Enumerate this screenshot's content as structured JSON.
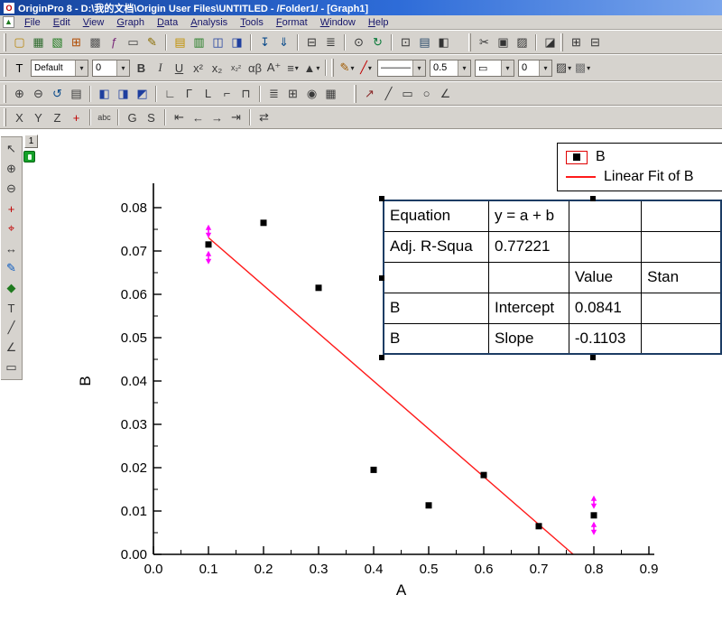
{
  "window": {
    "title": "OriginPro 8 - D:\\我的文档\\Origin User Files\\UNTITLED - /Folder1/ - [Graph1]"
  },
  "menu": {
    "items": [
      "File",
      "Edit",
      "View",
      "Graph",
      "Data",
      "Analysis",
      "Tools",
      "Format",
      "Window",
      "Help"
    ]
  },
  "toolbars": {
    "standard": [
      {
        "t": "g"
      },
      {
        "t": "i",
        "n": "new-project-icon",
        "g": "▢",
        "c": "#b8860b"
      },
      {
        "t": "i",
        "n": "new-workbook-icon",
        "g": "▦",
        "c": "#2e6b2e"
      },
      {
        "t": "i",
        "n": "new-excel-icon",
        "g": "▧",
        "c": "#1f7a1f"
      },
      {
        "t": "i",
        "n": "new-graph-icon",
        "g": "⊞",
        "c": "#b04a00"
      },
      {
        "t": "i",
        "n": "new-matrix-icon",
        "g": "▩",
        "c": "#555555"
      },
      {
        "t": "i",
        "n": "new-function-icon",
        "g": "ƒ",
        "c": "#7a2a7a"
      },
      {
        "t": "i",
        "n": "new-layout-icon",
        "g": "▭",
        "c": "#444444"
      },
      {
        "t": "i",
        "n": "new-notes-icon",
        "g": "✎",
        "c": "#8a6d00"
      },
      {
        "t": "s"
      },
      {
        "t": "i",
        "n": "open-icon",
        "g": "▤",
        "c": "#c09000"
      },
      {
        "t": "i",
        "n": "open-excel-icon",
        "g": "▥",
        "c": "#1f7a1f"
      },
      {
        "t": "i",
        "n": "save-project-icon",
        "g": "◫",
        "c": "#1f3f9f"
      },
      {
        "t": "i",
        "n": "save-template-icon",
        "g": "◨",
        "c": "#1f3f9f"
      },
      {
        "t": "s"
      },
      {
        "t": "i",
        "n": "import-wizard-icon",
        "g": "↧",
        "c": "#0a4a8a"
      },
      {
        "t": "i",
        "n": "import-ascii-icon",
        "g": "⇓",
        "c": "#0a4a8a"
      },
      {
        "t": "s"
      },
      {
        "t": "i",
        "n": "print-icon",
        "g": "⊟",
        "c": "#333333"
      },
      {
        "t": "i",
        "n": "script-window-icon",
        "g": "≣",
        "c": "#333333"
      },
      {
        "t": "s"
      },
      {
        "t": "i",
        "n": "zoom-tool-icon",
        "g": "⊙",
        "c": "#333333"
      },
      {
        "t": "i",
        "n": "refresh-icon",
        "g": "↻",
        "c": "#0a7a3a"
      },
      {
        "t": "s"
      },
      {
        "t": "i",
        "n": "project-explorer-icon",
        "g": "⊡",
        "c": "#333333"
      },
      {
        "t": "i",
        "n": "results-log-icon",
        "g": "▤",
        "c": "#2a4a6a"
      },
      {
        "t": "i",
        "n": "code-builder-icon",
        "g": "◧",
        "c": "#333333"
      },
      {
        "t": "gap",
        "w": 16
      },
      {
        "t": "g"
      },
      {
        "t": "i",
        "n": "cut-icon",
        "g": "✂",
        "c": "#333333"
      },
      {
        "t": "i",
        "n": "copy-icon",
        "g": "▣",
        "c": "#333333"
      },
      {
        "t": "i",
        "n": "paste-icon",
        "g": "▨",
        "c": "#333333"
      },
      {
        "t": "s"
      },
      {
        "t": "i",
        "n": "format-painter-icon",
        "g": "◪",
        "c": "#333333"
      },
      {
        "t": "g"
      },
      {
        "t": "i",
        "n": "layer-contents-icon",
        "g": "⊞",
        "c": "#333333"
      },
      {
        "t": "i",
        "n": "plot-setup-icon",
        "g": "⊟",
        "c": "#333333"
      }
    ],
    "format": [
      {
        "t": "g"
      },
      {
        "t": "i",
        "n": "text-style-icon",
        "g": "T",
        "c": "#000000"
      },
      {
        "t": "c",
        "n": "font-combo",
        "val": "Default",
        "w": 64
      },
      {
        "t": "c",
        "n": "font-size-combo",
        "val": "0",
        "w": 42
      },
      {
        "t": "i",
        "n": "bold-button",
        "g": "B",
        "b": 1
      },
      {
        "t": "i",
        "n": "italic-button",
        "g": "I",
        "i": 1
      },
      {
        "t": "i",
        "n": "underline-button",
        "g": "U",
        "u": 1
      },
      {
        "t": "i",
        "n": "superscript-button",
        "g": "x²"
      },
      {
        "t": "i",
        "n": "subscript-button",
        "g": "x₂"
      },
      {
        "t": "i",
        "n": "subsuperscript-button",
        "g": "x₂²"
      },
      {
        "t": "i",
        "n": "greek-button",
        "g": "αβ"
      },
      {
        "t": "i",
        "n": "font-grow-button",
        "g": "A⁺"
      },
      {
        "t": "i",
        "n": "align-dropdown",
        "g": "≡",
        "d": 1
      },
      {
        "t": "i",
        "n": "symbol-dropdown",
        "g": "▲",
        "d": 1
      },
      {
        "t": "s"
      },
      {
        "t": "g"
      },
      {
        "t": "i",
        "n": "pencil-color-dropdown",
        "g": "✎",
        "c": "#a05a00",
        "d": 1
      },
      {
        "t": "i",
        "n": "line-color-dropdown",
        "g": "╱",
        "c": "#c00000",
        "d": 1
      },
      {
        "t": "c",
        "n": "line-style-combo",
        "val": "———",
        "w": 54
      },
      {
        "t": "c",
        "n": "line-width-combo",
        "val": "0.5",
        "w": 46
      },
      {
        "t": "c",
        "n": "frame-style-combo",
        "val": "▭",
        "w": 44
      },
      {
        "t": "c",
        "n": "frame-width-combo",
        "val": "0",
        "w": 38
      },
      {
        "t": "i",
        "n": "pattern-dropdown",
        "g": "▨",
        "d": 1
      },
      {
        "t": "i",
        "n": "fill-color-dropdown",
        "g": "▩",
        "c": "#777777",
        "d": 1
      }
    ],
    "graph": [
      {
        "t": "g"
      },
      {
        "t": "i",
        "n": "zoom-in-icon",
        "g": "⊕"
      },
      {
        "t": "i",
        "n": "zoom-out-icon",
        "g": "⊖"
      },
      {
        "t": "i",
        "n": "rescale-icon",
        "g": "↺",
        "c": "#0a4a8a"
      },
      {
        "t": "i",
        "n": "whole-page-icon",
        "g": "▤"
      },
      {
        "t": "s"
      },
      {
        "t": "i",
        "n": "add-layer-left-icon",
        "g": "◧",
        "c": "#1f3f9f"
      },
      {
        "t": "i",
        "n": "add-layer-right-icon",
        "g": "◨",
        "c": "#1f3f9f"
      },
      {
        "t": "i",
        "n": "add-inset-layer-icon",
        "g": "◩",
        "c": "#1f3f9f"
      },
      {
        "t": "s"
      },
      {
        "t": "i",
        "n": "axis-bottom-icon",
        "g": "∟"
      },
      {
        "t": "i",
        "n": "axis-top-icon",
        "g": "Γ"
      },
      {
        "t": "i",
        "n": "axis-left-icon",
        "g": "L"
      },
      {
        "t": "i",
        "n": "axis-right-icon",
        "g": "⌐"
      },
      {
        "t": "i",
        "n": "axis-box-icon",
        "g": "⊓"
      },
      {
        "t": "s"
      },
      {
        "t": "i",
        "n": "object-align-icon",
        "g": "≣"
      },
      {
        "t": "i",
        "n": "merge-graph-icon",
        "g": "⊞"
      },
      {
        "t": "i",
        "n": "date-time-stamp-icon",
        "g": "◉"
      },
      {
        "t": "i",
        "n": "new-table-icon",
        "g": "▦"
      },
      {
        "t": "gap",
        "w": 14
      },
      {
        "t": "g"
      },
      {
        "t": "i",
        "n": "draw-arrow-icon",
        "g": "↗",
        "c": "#8a2a2a"
      },
      {
        "t": "i",
        "n": "draw-line-icon",
        "g": "╱"
      },
      {
        "t": "i",
        "n": "draw-rect-icon",
        "g": "▭"
      },
      {
        "t": "i",
        "n": "draw-circle-icon",
        "g": "○"
      },
      {
        "t": "i",
        "n": "draw-polyline-icon",
        "g": "∠"
      }
    ],
    "object": [
      {
        "t": "g"
      },
      {
        "t": "i",
        "n": "x-axis-button",
        "g": "X"
      },
      {
        "t": "i",
        "n": "y-axis-button",
        "g": "Y"
      },
      {
        "t": "i",
        "n": "z-axis-button",
        "g": "Z"
      },
      {
        "t": "i",
        "n": "add-point-button",
        "g": "+",
        "c": "#c00000"
      },
      {
        "t": "s"
      },
      {
        "t": "i",
        "n": "rotate-text-icon",
        "g": "abc"
      },
      {
        "t": "s"
      },
      {
        "t": "i",
        "n": "group-button",
        "g": "G"
      },
      {
        "t": "i",
        "n": "spacing-button",
        "g": "S"
      },
      {
        "t": "s"
      },
      {
        "t": "i",
        "n": "send-to-back-icon",
        "g": "⇤"
      },
      {
        "t": "i",
        "n": "move-back-icon",
        "g": "←"
      },
      {
        "t": "i",
        "n": "move-front-icon",
        "g": "→"
      },
      {
        "t": "i",
        "n": "bring-to-front-icon",
        "g": "⇥"
      },
      {
        "t": "s"
      },
      {
        "t": "i",
        "n": "swap-icon",
        "g": "⇄"
      }
    ],
    "tools": [
      {
        "t": "i",
        "n": "pointer-tool-icon",
        "g": "↖"
      },
      {
        "t": "i",
        "n": "zoom-in-tool-icon",
        "g": "⊕"
      },
      {
        "t": "i",
        "n": "zoom-out-tool-icon",
        "g": "⊖"
      },
      {
        "t": "i",
        "n": "screen-reader-tool-icon",
        "g": "+",
        "c": "#c00000"
      },
      {
        "t": "i",
        "n": "data-reader-tool-icon",
        "g": "⌖",
        "c": "#c00000"
      },
      {
        "t": "i",
        "n": "data-selector-tool-icon",
        "g": "↔"
      },
      {
        "t": "i",
        "n": "draw-data-tool-icon",
        "g": "✎",
        "c": "#0a5ac0"
      },
      {
        "t": "i",
        "n": "mask-tool-icon",
        "g": "◆",
        "c": "#1f7a1f"
      },
      {
        "t": "i",
        "n": "text-tool-icon",
        "g": "T"
      },
      {
        "t": "i",
        "n": "line-tool-icon",
        "g": "╱"
      },
      {
        "t": "i",
        "n": "polyline-tool-icon",
        "g": "∠"
      },
      {
        "t": "i",
        "n": "rectangle-tool-icon",
        "g": "▭"
      }
    ]
  },
  "graph": {
    "layer_label": "1"
  },
  "legend": {
    "items": [
      {
        "label": "B"
      },
      {
        "label": "Linear Fit of B"
      }
    ],
    "marker_color": "#000000",
    "line_color": "#ff1a1a"
  },
  "results_table": {
    "rows": [
      [
        "Equation",
        "y = a + b",
        "",
        ""
      ],
      [
        "Adj. R-Squa",
        "0.77221",
        "",
        ""
      ],
      [
        "",
        "",
        "Value",
        "Stan"
      ],
      [
        "B",
        "Intercept",
        "0.0841",
        ""
      ],
      [
        "B",
        "Slope",
        "-0.1103",
        ""
      ]
    ]
  },
  "chart_data": {
    "type": "scatter",
    "title": "",
    "xlabel": "A",
    "ylabel": "B",
    "xlim": [
      0.0,
      0.9
    ],
    "ylim": [
      0.0,
      0.08
    ],
    "xticks": [
      0.0,
      0.1,
      0.2,
      0.3,
      0.4,
      0.5,
      0.6,
      0.7,
      0.8,
      0.9
    ],
    "xtick_labels": [
      "0.0",
      "0.1",
      "0.2",
      "0.3",
      "0.4",
      "0.5",
      "0.6",
      "0.7",
      "0.8",
      "0.9"
    ],
    "yticks": [
      0.0,
      0.01,
      0.02,
      0.03,
      0.04,
      0.05,
      0.06,
      0.07,
      0.08
    ],
    "ytick_labels": [
      "0.00",
      "0.01",
      "0.02",
      "0.03",
      "0.04",
      "0.05",
      "0.06",
      "0.07",
      "0.08"
    ],
    "grid": false,
    "legend_position": "top-right",
    "series": [
      {
        "name": "B",
        "type": "scatter",
        "marker": "square",
        "color": "#000000",
        "x": [
          0.1,
          0.2,
          0.3,
          0.4,
          0.5,
          0.6,
          0.7,
          0.8
        ],
        "y": [
          0.0715,
          0.0765,
          0.0615,
          0.0195,
          0.0113,
          0.0183,
          0.0065,
          0.009
        ]
      },
      {
        "name": "Linear Fit of B",
        "type": "line",
        "color": "#ff1a1a",
        "fit": {
          "equation": "y = a + b",
          "intercept": 0.0841,
          "slope": -0.1103,
          "adj_r_square": 0.77221,
          "x_start": 0.1,
          "x_end": 0.7625
        }
      }
    ],
    "selected_point_indices": [
      0,
      7
    ],
    "selection_color": "#ff00ff"
  }
}
